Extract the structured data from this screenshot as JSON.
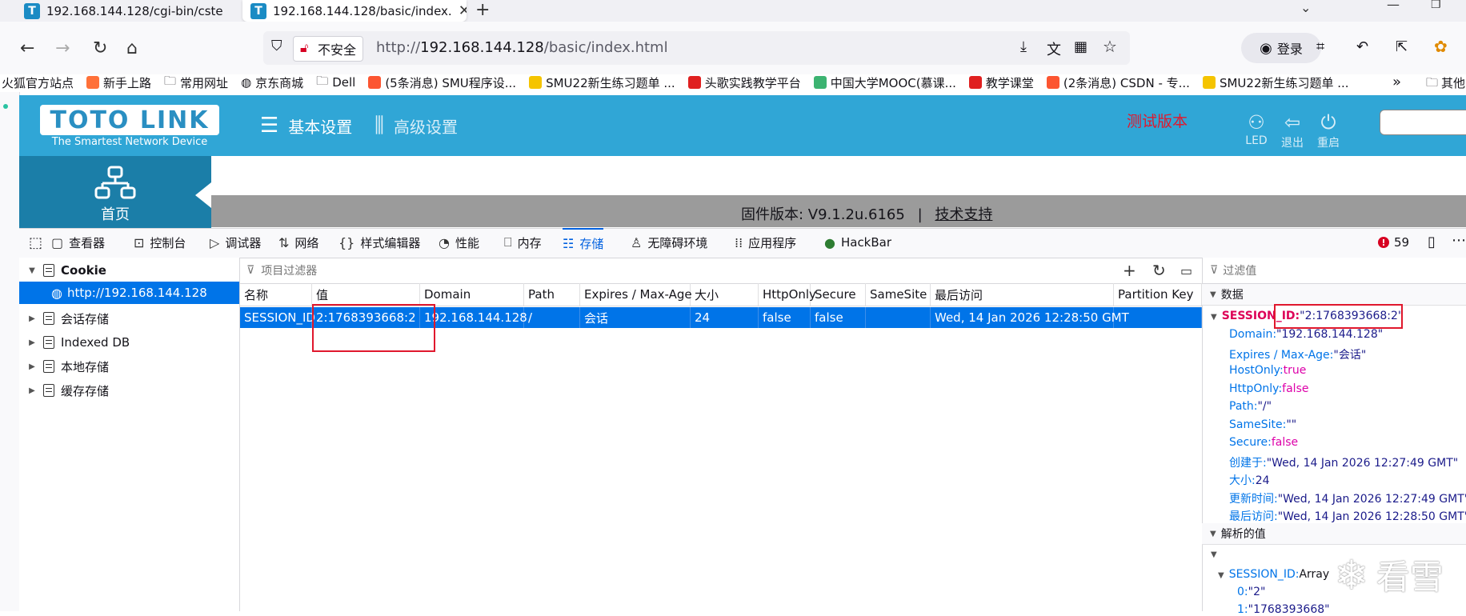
{
  "browser": {
    "tabs": [
      {
        "label": "192.168.144.128/cgi-bin/cste",
        "active": false
      },
      {
        "label": "192.168.144.128/basic/index.",
        "active": true
      }
    ],
    "new_tab": "+",
    "insecure_label": "不安全",
    "url_prefix": "http://",
    "url_host": "192.168.144.128",
    "url_path": "/basic/index.html",
    "login_label": "登录",
    "bookmarks": [
      {
        "label": "火狐官方站点",
        "icon": "none",
        "color": ""
      },
      {
        "label": "新手上路",
        "icon": "firefox-icon",
        "color": "#ff7139"
      },
      {
        "label": "常用网址",
        "icon": "folder-icon",
        "color": ""
      },
      {
        "label": "京东商城",
        "icon": "globe-icon",
        "color": ""
      },
      {
        "label": "Dell",
        "icon": "folder-icon",
        "color": ""
      },
      {
        "label": "(5条消息) SMU程序设...",
        "icon": "csdn-icon",
        "color": "#fc5531"
      },
      {
        "label": "SMU22新生练习题单 ...",
        "icon": "smile-icon",
        "color": "#f5c400"
      },
      {
        "label": "头歌实践教学平台",
        "icon": "touge-icon",
        "color": "#e02020"
      },
      {
        "label": "中国大学MOOC(慕课...",
        "icon": "mooc-icon",
        "color": "#3cb371"
      },
      {
        "label": "教学课堂",
        "icon": "touge-icon",
        "color": "#e02020"
      },
      {
        "label": "(2条消息) CSDN - 专...",
        "icon": "csdn-icon",
        "color": "#fc5531"
      },
      {
        "label": "SMU22新生练习题单 ...",
        "icon": "smile-icon",
        "color": "#f5c400"
      }
    ],
    "bookmarks_more": "»",
    "bookmarks_other": "其他"
  },
  "site": {
    "logo_text": "TOTO LINK",
    "logo_tagline": "The Smartest Network Device",
    "menu_basic": "基本设置",
    "menu_advanced": "高级设置",
    "test_version": "测试版本",
    "header_icons": [
      {
        "label": "LED",
        "icon": "led-icon"
      },
      {
        "label": "退出",
        "icon": "logout-icon"
      },
      {
        "label": "重启",
        "icon": "power-icon"
      }
    ],
    "home_label": "首页",
    "firmware_label": "固件版本: V9.1.2u.6165",
    "separator": "|",
    "support_link": "技术支持"
  },
  "devtools": {
    "tabs": [
      {
        "label": "查看器",
        "icon": "inspector-icon"
      },
      {
        "label": "控制台",
        "icon": "console-icon"
      },
      {
        "label": "调试器",
        "icon": "debugger-icon"
      },
      {
        "label": "网络",
        "icon": "network-icon"
      },
      {
        "label": "样式编辑器",
        "icon": "style-editor-icon"
      },
      {
        "label": "性能",
        "icon": "performance-icon"
      },
      {
        "label": "内存",
        "icon": "memory-icon"
      },
      {
        "label": "存储",
        "icon": "storage-icon"
      },
      {
        "label": "无障碍环境",
        "icon": "accessibility-icon"
      },
      {
        "label": "应用程序",
        "icon": "application-icon"
      },
      {
        "label": "HackBar",
        "icon": "hackbar-icon"
      }
    ],
    "selected_tab": "存储",
    "error_count": "59",
    "tree": [
      {
        "label": "Cookie",
        "expanded": true
      },
      {
        "label": "http://192.168.144.128",
        "child": true,
        "selected": true
      },
      {
        "label": "会话存储",
        "expanded": false
      },
      {
        "label": "Indexed DB",
        "expanded": false
      },
      {
        "label": "本地存储",
        "expanded": false
      },
      {
        "label": "缓存存储",
        "expanded": false
      }
    ],
    "filter_placeholder": "项目过滤器",
    "columns": [
      "名称",
      "值",
      "Domain",
      "Path",
      "Expires / Max-Age",
      "大小",
      "HttpOnly",
      "Secure",
      "SameSite",
      "最后访问",
      "Partition Key"
    ],
    "rows": [
      [
        "SESSION_ID",
        "2:1768393668:2",
        "192.168.144.128",
        "/",
        "会话",
        "24",
        "false",
        "false",
        "",
        "Wed, 14 Jan 2026 12:28:50 GMT",
        ""
      ]
    ],
    "sidebar": {
      "filter_placeholder": "过滤值",
      "data_header": "数据",
      "cookie_key": "SESSION_ID",
      "cookie_value": "\"2:1768393668:2\"",
      "props": [
        {
          "k": "Domain",
          "v": "\"192.168.144.128\"",
          "t": "s"
        },
        {
          "k": "Expires / Max-Age",
          "v": "\"会话\"",
          "t": "s"
        },
        {
          "k": "HostOnly",
          "v": "true",
          "t": "b"
        },
        {
          "k": "HttpOnly",
          "v": "false",
          "t": "b"
        },
        {
          "k": "Path",
          "v": "\"/\"",
          "t": "s"
        },
        {
          "k": "SameSite",
          "v": "\"\"",
          "t": "s"
        },
        {
          "k": "Secure",
          "v": "false",
          "t": "b"
        },
        {
          "k": "创建于",
          "v": "\"Wed, 14 Jan 2026 12:27:49 GMT\"",
          "t": "s"
        },
        {
          "k": "大小",
          "v": "24",
          "t": "n"
        },
        {
          "k": "更新时间",
          "v": "\"Wed, 14 Jan 2026 12:27:49 GMT\"",
          "t": "s"
        },
        {
          "k": "最后访问",
          "v": "\"Wed, 14 Jan 2026 12:28:50 GMT\"",
          "t": "s"
        }
      ],
      "parsed_header": "解析的值",
      "parsed_key": "SESSION_ID",
      "parsed_type": "Array",
      "parsed_items": [
        {
          "k": "0",
          "v": "\"2\""
        },
        {
          "k": "1",
          "v": "\"1768393668\""
        }
      ]
    }
  },
  "watermark": "看雪"
}
